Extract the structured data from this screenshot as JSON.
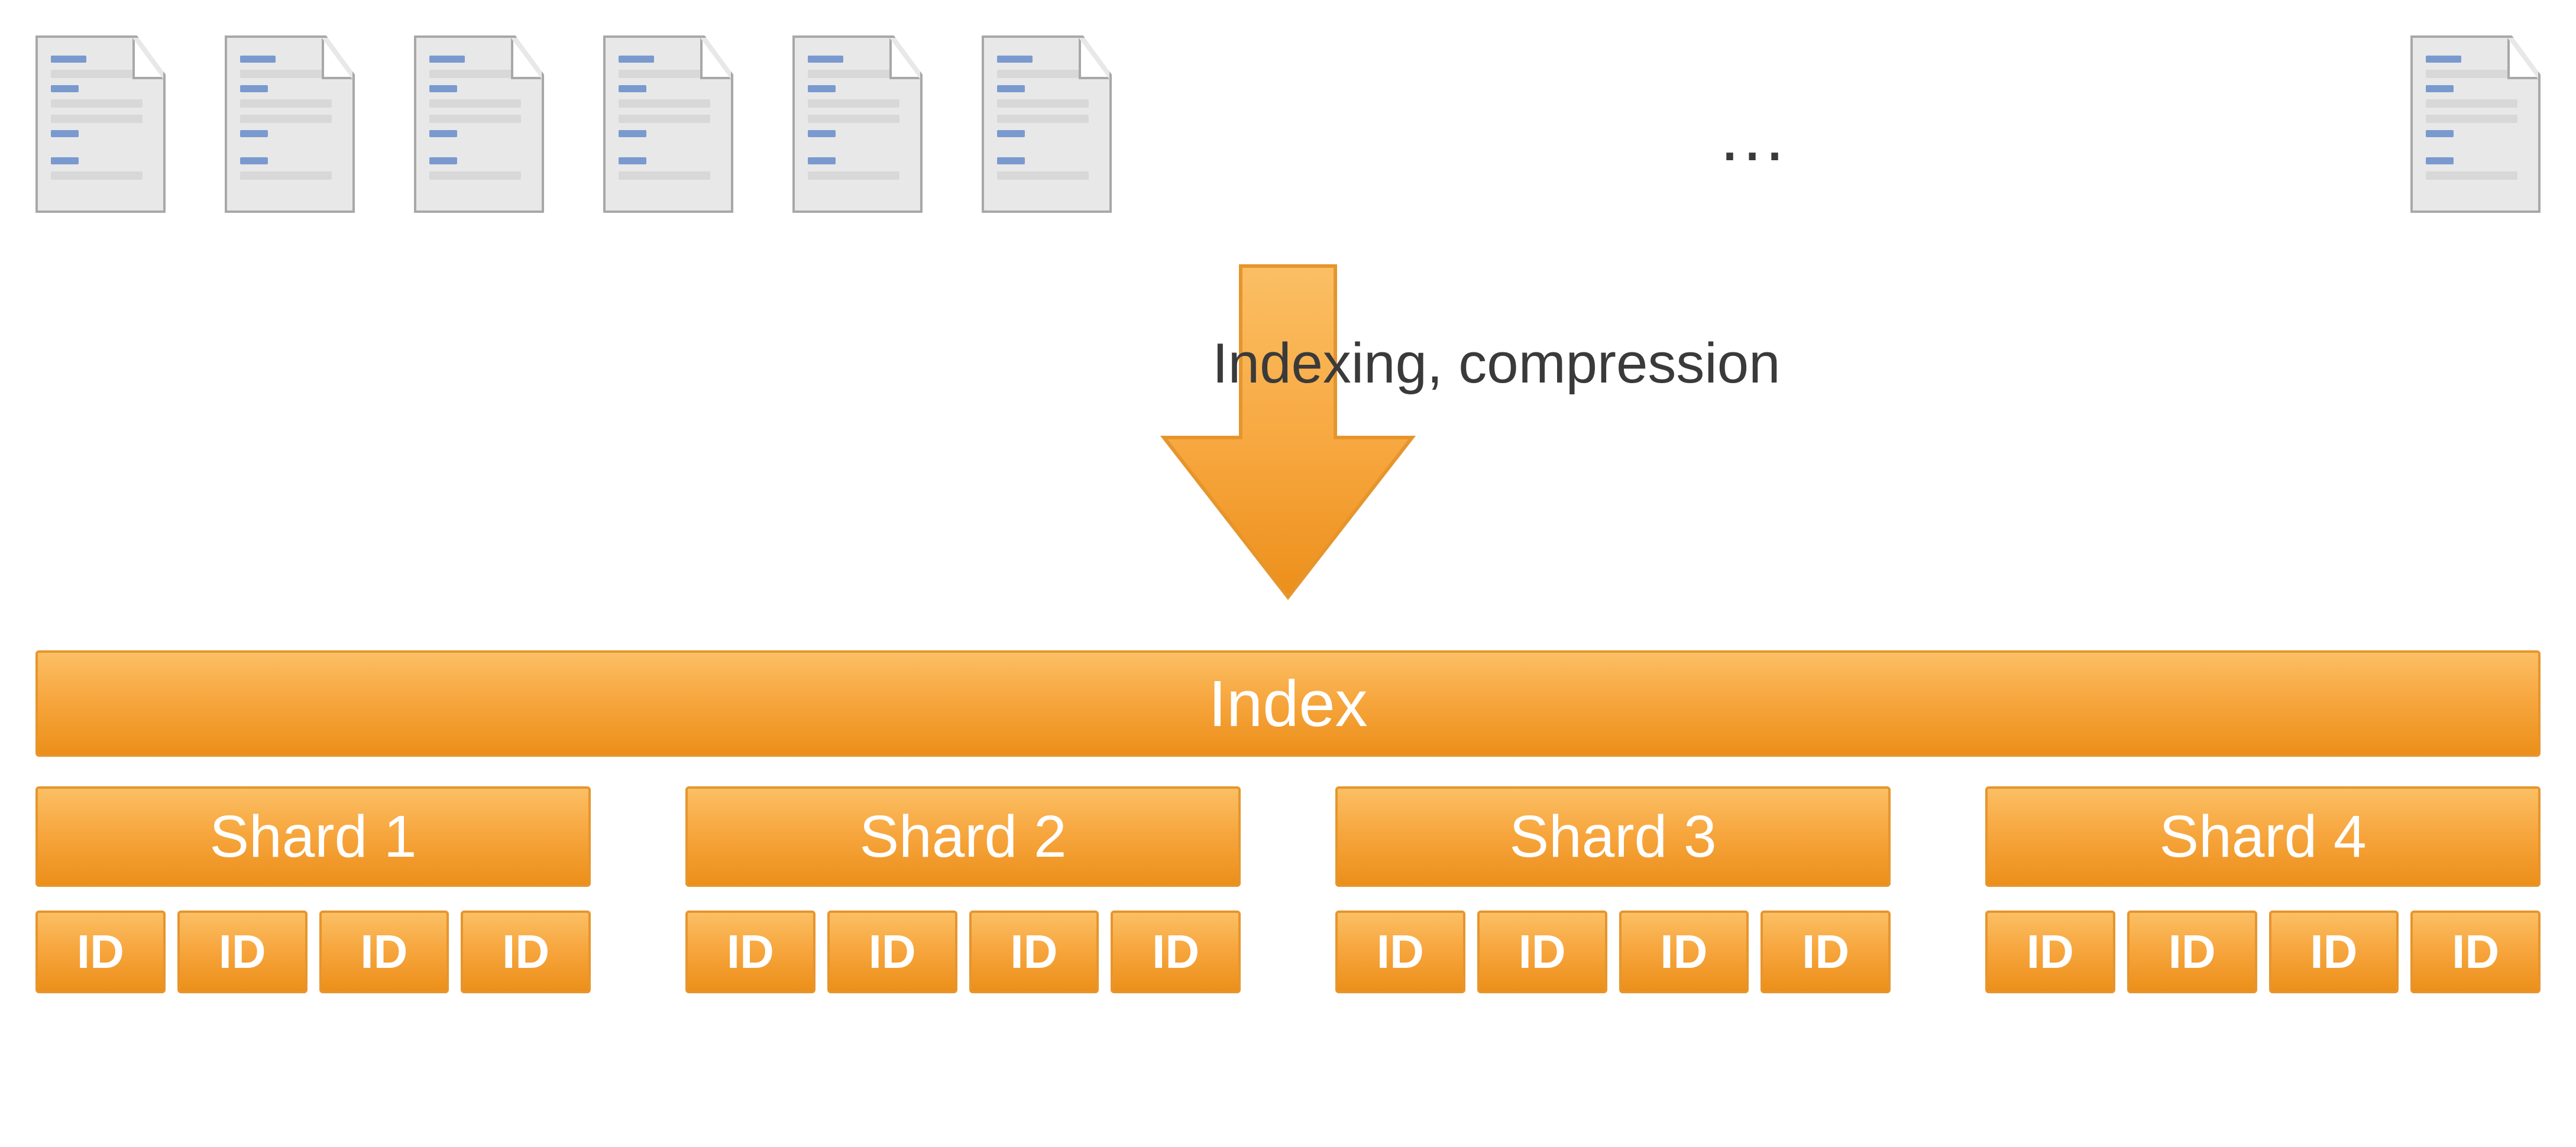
{
  "documents": {
    "count_left": 6,
    "ellipsis": "…",
    "count_right": 1
  },
  "arrow_label": "Indexing, compression",
  "index_label": "Index",
  "shards": [
    {
      "label": "Shard 1",
      "ids": [
        "ID",
        "ID",
        "ID",
        "ID"
      ]
    },
    {
      "label": "Shard 2",
      "ids": [
        "ID",
        "ID",
        "ID",
        "ID"
      ]
    },
    {
      "label": "Shard 3",
      "ids": [
        "ID",
        "ID",
        "ID",
        "ID"
      ]
    },
    {
      "label": "Shard 4",
      "ids": [
        "ID",
        "ID",
        "ID",
        "ID"
      ]
    }
  ]
}
